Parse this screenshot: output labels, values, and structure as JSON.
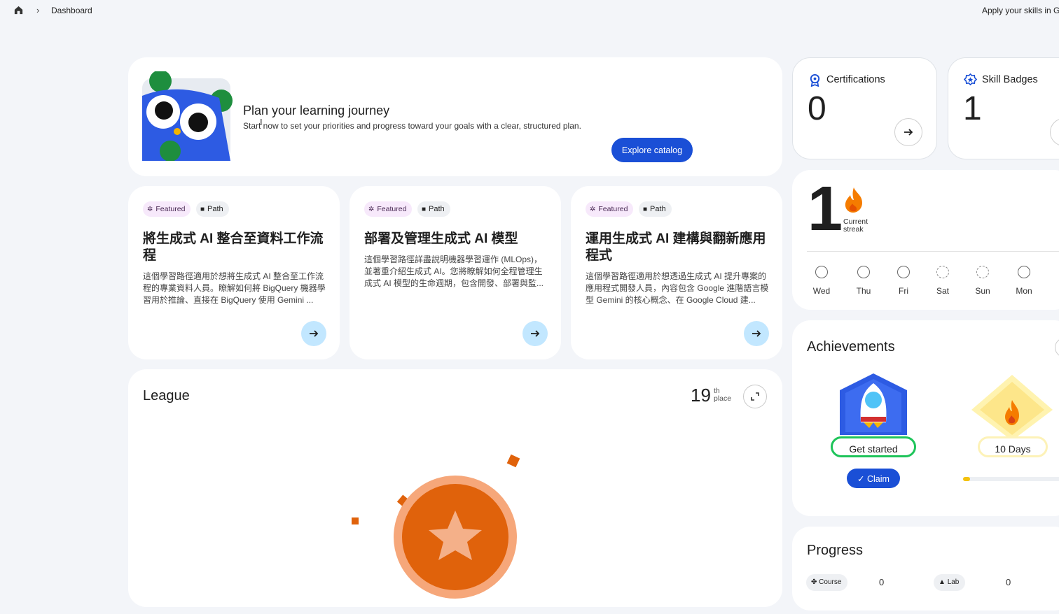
{
  "topbar": {
    "breadcrumb": "Dashboard",
    "right_text": "Apply your skills in G"
  },
  "hero": {
    "title": "Plan your learning journey",
    "subtitle": "Start now to set your priorities and progress toward your goals with a clear, structured plan.",
    "button_label": "Explore catalog"
  },
  "path_cards": [
    {
      "chip_featured": "Featured",
      "chip_path": "Path",
      "title": "將生成式 AI 整合至資料工作流程",
      "description": "這個學習路徑適用於想將生成式 AI 整合至工作流程的專業資料人員。瞭解如何將 BigQuery 機器學習用於推論、直接在 BigQuery 使用 Gemini ..."
    },
    {
      "chip_featured": "Featured",
      "chip_path": "Path",
      "title": "部署及管理生成式 AI 模型",
      "description": "這個學習路徑詳盡說明機器學習運作 (MLOps)，並著重介紹生成式 AI。您將瞭解如何全程管理生成式 AI 模型的生命週期，包含開發、部署與監..."
    },
    {
      "chip_featured": "Featured",
      "chip_path": "Path",
      "title": "運用生成式 AI 建構與翻新應用程式",
      "description": "這個學習路徑適用於想透過生成式 AI 提升專案的應用程式開發人員，內容包含 Google 進階語言模型 Gemini 的核心概念、在 Google Cloud 建..."
    }
  ],
  "league": {
    "title": "League",
    "rank": "19",
    "rank_suffix_top": "th",
    "rank_suffix_bottom": "place"
  },
  "stats": {
    "certifications": {
      "label": "Certifications",
      "value": "0"
    },
    "skill_badges": {
      "label": "Skill Badges",
      "value": "1"
    }
  },
  "streak": {
    "value": "1",
    "label_line1": "Current",
    "label_line2": "streak",
    "days": [
      "Wed",
      "Thu",
      "Fri",
      "Sat",
      "Sun",
      "Mon"
    ]
  },
  "achievements": {
    "title": "Achievements",
    "items": [
      {
        "label": "Get started",
        "button": "Claim"
      },
      {
        "label": "10 Days",
        "progress": 0.06
      }
    ]
  },
  "progress": {
    "title": "Progress",
    "course_label": "Course",
    "course_count": "0",
    "lab_label": "Lab",
    "lab_count": "0"
  },
  "colors": {
    "accent": "#1a4fd6",
    "background": "#f3f5f9",
    "arrow_bg": "#c2e7ff",
    "featured_chip": "#f7e9fb",
    "streak_flame": "#f57c00",
    "progress_fill": "#f4c20d"
  }
}
